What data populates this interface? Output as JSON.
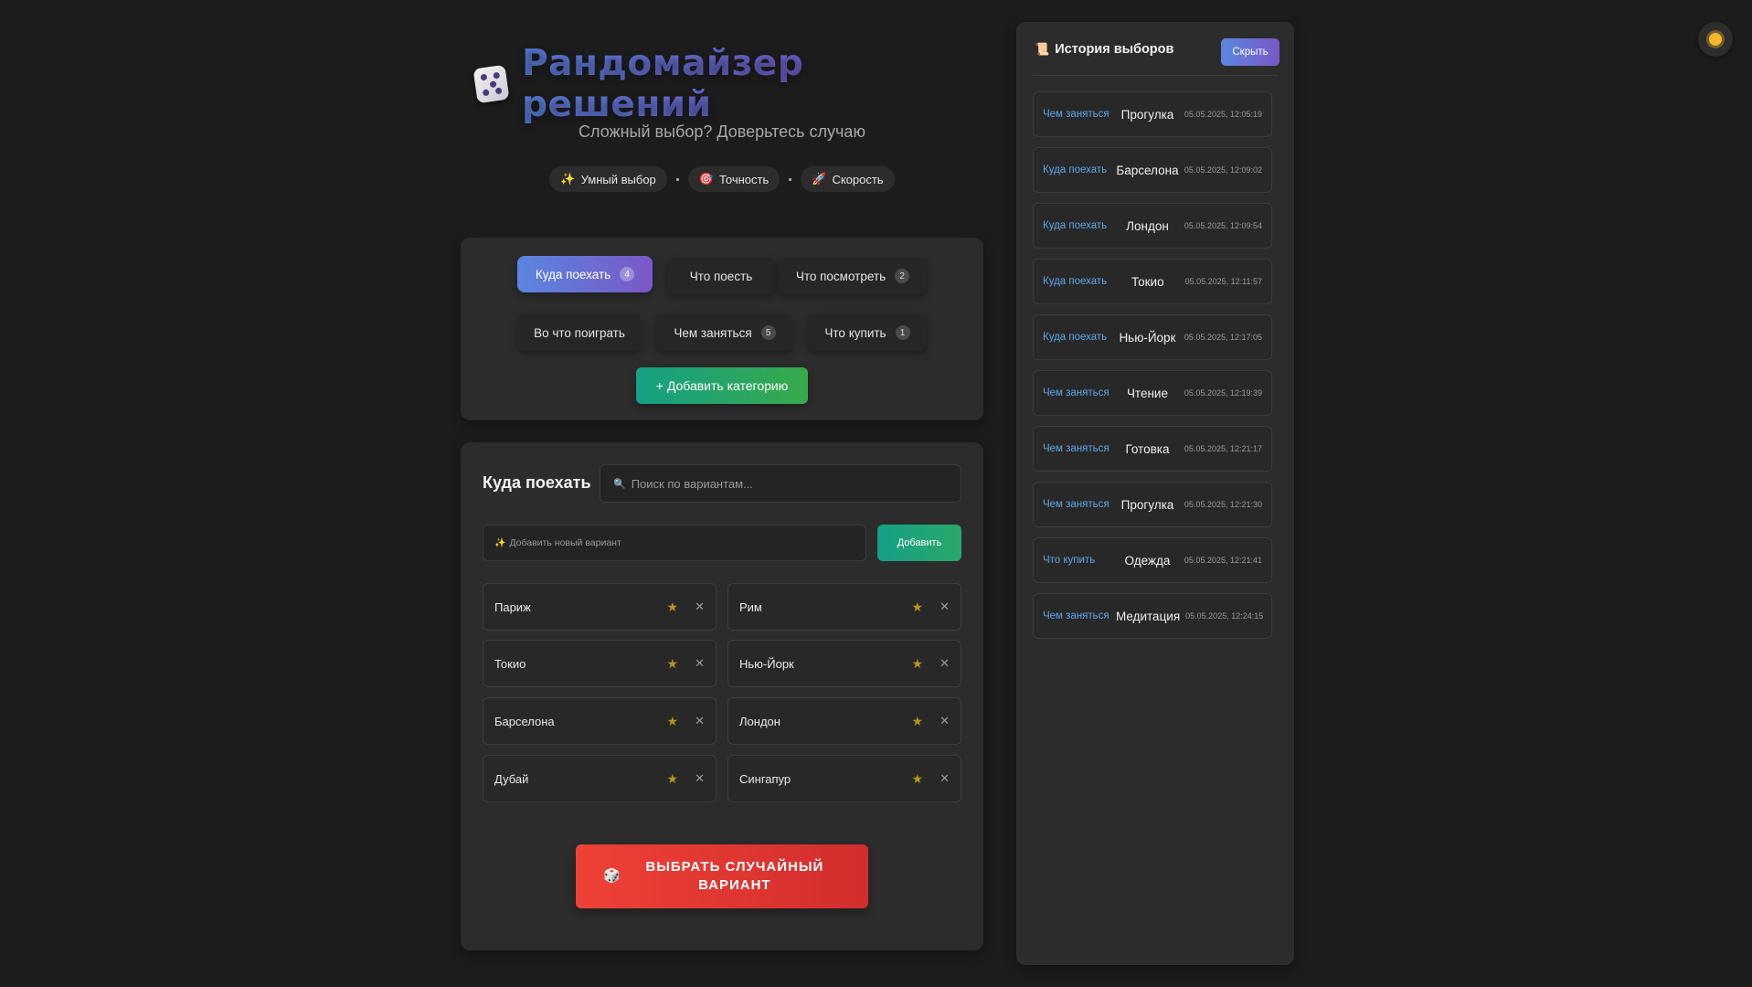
{
  "header": {
    "title": "Рандомайзер решений",
    "subtitle": "Сложный выбор? Доверьтесь случаю",
    "features": [
      {
        "icon": "sparkles-icon",
        "glyph": "✨",
        "label": "Умный выбор"
      },
      {
        "icon": "target-icon",
        "glyph": "🎯",
        "label": "Точность"
      },
      {
        "icon": "rocket-icon",
        "glyph": "🚀",
        "label": "Скорость"
      }
    ]
  },
  "categories": {
    "items": [
      {
        "label": "Куда поехать",
        "count": "4",
        "active": true
      },
      {
        "label": "Что поесть",
        "count": "",
        "active": false
      },
      {
        "label": "Что посмотреть",
        "count": "2",
        "active": false
      },
      {
        "label": "Во что поиграть",
        "count": "",
        "active": false
      },
      {
        "label": "Чем заняться",
        "count": "5",
        "active": false
      },
      {
        "label": "Что купить",
        "count": "1",
        "active": false
      }
    ],
    "add_label": "+ Добавить категорию"
  },
  "options": {
    "title": "Куда поехать",
    "search_placeholder": "Поиск по вариантам...",
    "add_placeholder": "Добавить новый вариант",
    "add_button": "Добавить",
    "items": [
      "Париж",
      "Рим",
      "Токио",
      "Нью-Йорк",
      "Барселона",
      "Лондон",
      "Дубай",
      "Сингапур"
    ],
    "random_button": "ВЫБРАТЬ СЛУЧАЙНЫЙ ВАРИАНТ"
  },
  "history": {
    "title": "История выборов",
    "hide_label": "Скрыть",
    "items": [
      {
        "category": "Чем заняться",
        "value": "Прогулка",
        "time": "05.05.2025, 12:05:19"
      },
      {
        "category": "Куда поехать",
        "value": "Барселона",
        "time": "05.05.2025, 12:09:02"
      },
      {
        "category": "Куда поехать",
        "value": "Лондон",
        "time": "05.05.2025, 12:09:54"
      },
      {
        "category": "Куда поехать",
        "value": "Токио",
        "time": "05.05.2025, 12:11:57"
      },
      {
        "category": "Куда поехать",
        "value": "Нью-Йорк",
        "time": "05.05.2025, 12:17:05"
      },
      {
        "category": "Чем заняться",
        "value": "Чтение",
        "time": "05.05.2025, 12:19:39"
      },
      {
        "category": "Чем заняться",
        "value": "Готовка",
        "time": "05.05.2025, 12:21:17"
      },
      {
        "category": "Чем заняться",
        "value": "Прогулка",
        "time": "05.05.2025, 12:21:30"
      },
      {
        "category": "Что купить",
        "value": "Одежда",
        "time": "05.05.2025, 12:21:41"
      },
      {
        "category": "Чем заняться",
        "value": "Медитация",
        "time": "05.05.2025, 12:24:15"
      }
    ]
  },
  "theme": {
    "icon": "sun-icon"
  },
  "colors": {
    "background": "#1c1c1c",
    "panel": "#2c2c2c",
    "accent_gradient_start": "#5a86e0",
    "accent_gradient_end": "#7a58c6",
    "add_green": "#15a085",
    "random_red": "#ef4137",
    "star": "#b8941c",
    "history_category": "#5da6e8"
  }
}
